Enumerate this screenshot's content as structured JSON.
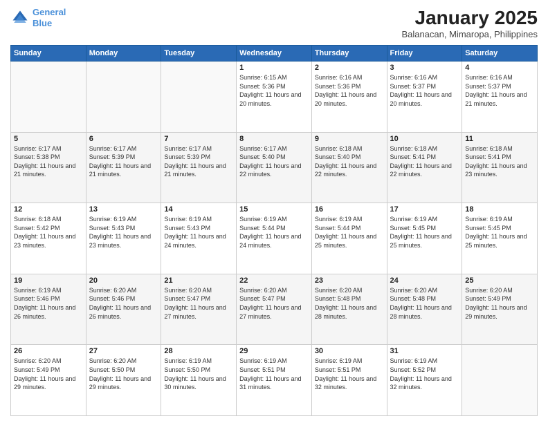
{
  "header": {
    "logo_line1": "General",
    "logo_line2": "Blue",
    "month_title": "January 2025",
    "location": "Balanacan, Mimaropa, Philippines"
  },
  "days_of_week": [
    "Sunday",
    "Monday",
    "Tuesday",
    "Wednesday",
    "Thursday",
    "Friday",
    "Saturday"
  ],
  "weeks": [
    [
      {
        "day": "",
        "sunrise": "",
        "sunset": "",
        "daylight": ""
      },
      {
        "day": "",
        "sunrise": "",
        "sunset": "",
        "daylight": ""
      },
      {
        "day": "",
        "sunrise": "",
        "sunset": "",
        "daylight": ""
      },
      {
        "day": "1",
        "sunrise": "Sunrise: 6:15 AM",
        "sunset": "Sunset: 5:36 PM",
        "daylight": "Daylight: 11 hours and 20 minutes."
      },
      {
        "day": "2",
        "sunrise": "Sunrise: 6:16 AM",
        "sunset": "Sunset: 5:36 PM",
        "daylight": "Daylight: 11 hours and 20 minutes."
      },
      {
        "day": "3",
        "sunrise": "Sunrise: 6:16 AM",
        "sunset": "Sunset: 5:37 PM",
        "daylight": "Daylight: 11 hours and 20 minutes."
      },
      {
        "day": "4",
        "sunrise": "Sunrise: 6:16 AM",
        "sunset": "Sunset: 5:37 PM",
        "daylight": "Daylight: 11 hours and 21 minutes."
      }
    ],
    [
      {
        "day": "5",
        "sunrise": "Sunrise: 6:17 AM",
        "sunset": "Sunset: 5:38 PM",
        "daylight": "Daylight: 11 hours and 21 minutes."
      },
      {
        "day": "6",
        "sunrise": "Sunrise: 6:17 AM",
        "sunset": "Sunset: 5:39 PM",
        "daylight": "Daylight: 11 hours and 21 minutes."
      },
      {
        "day": "7",
        "sunrise": "Sunrise: 6:17 AM",
        "sunset": "Sunset: 5:39 PM",
        "daylight": "Daylight: 11 hours and 21 minutes."
      },
      {
        "day": "8",
        "sunrise": "Sunrise: 6:17 AM",
        "sunset": "Sunset: 5:40 PM",
        "daylight": "Daylight: 11 hours and 22 minutes."
      },
      {
        "day": "9",
        "sunrise": "Sunrise: 6:18 AM",
        "sunset": "Sunset: 5:40 PM",
        "daylight": "Daylight: 11 hours and 22 minutes."
      },
      {
        "day": "10",
        "sunrise": "Sunrise: 6:18 AM",
        "sunset": "Sunset: 5:41 PM",
        "daylight": "Daylight: 11 hours and 22 minutes."
      },
      {
        "day": "11",
        "sunrise": "Sunrise: 6:18 AM",
        "sunset": "Sunset: 5:41 PM",
        "daylight": "Daylight: 11 hours and 23 minutes."
      }
    ],
    [
      {
        "day": "12",
        "sunrise": "Sunrise: 6:18 AM",
        "sunset": "Sunset: 5:42 PM",
        "daylight": "Daylight: 11 hours and 23 minutes."
      },
      {
        "day": "13",
        "sunrise": "Sunrise: 6:19 AM",
        "sunset": "Sunset: 5:43 PM",
        "daylight": "Daylight: 11 hours and 23 minutes."
      },
      {
        "day": "14",
        "sunrise": "Sunrise: 6:19 AM",
        "sunset": "Sunset: 5:43 PM",
        "daylight": "Daylight: 11 hours and 24 minutes."
      },
      {
        "day": "15",
        "sunrise": "Sunrise: 6:19 AM",
        "sunset": "Sunset: 5:44 PM",
        "daylight": "Daylight: 11 hours and 24 minutes."
      },
      {
        "day": "16",
        "sunrise": "Sunrise: 6:19 AM",
        "sunset": "Sunset: 5:44 PM",
        "daylight": "Daylight: 11 hours and 25 minutes."
      },
      {
        "day": "17",
        "sunrise": "Sunrise: 6:19 AM",
        "sunset": "Sunset: 5:45 PM",
        "daylight": "Daylight: 11 hours and 25 minutes."
      },
      {
        "day": "18",
        "sunrise": "Sunrise: 6:19 AM",
        "sunset": "Sunset: 5:45 PM",
        "daylight": "Daylight: 11 hours and 25 minutes."
      }
    ],
    [
      {
        "day": "19",
        "sunrise": "Sunrise: 6:19 AM",
        "sunset": "Sunset: 5:46 PM",
        "daylight": "Daylight: 11 hours and 26 minutes."
      },
      {
        "day": "20",
        "sunrise": "Sunrise: 6:20 AM",
        "sunset": "Sunset: 5:46 PM",
        "daylight": "Daylight: 11 hours and 26 minutes."
      },
      {
        "day": "21",
        "sunrise": "Sunrise: 6:20 AM",
        "sunset": "Sunset: 5:47 PM",
        "daylight": "Daylight: 11 hours and 27 minutes."
      },
      {
        "day": "22",
        "sunrise": "Sunrise: 6:20 AM",
        "sunset": "Sunset: 5:47 PM",
        "daylight": "Daylight: 11 hours and 27 minutes."
      },
      {
        "day": "23",
        "sunrise": "Sunrise: 6:20 AM",
        "sunset": "Sunset: 5:48 PM",
        "daylight": "Daylight: 11 hours and 28 minutes."
      },
      {
        "day": "24",
        "sunrise": "Sunrise: 6:20 AM",
        "sunset": "Sunset: 5:48 PM",
        "daylight": "Daylight: 11 hours and 28 minutes."
      },
      {
        "day": "25",
        "sunrise": "Sunrise: 6:20 AM",
        "sunset": "Sunset: 5:49 PM",
        "daylight": "Daylight: 11 hours and 29 minutes."
      }
    ],
    [
      {
        "day": "26",
        "sunrise": "Sunrise: 6:20 AM",
        "sunset": "Sunset: 5:49 PM",
        "daylight": "Daylight: 11 hours and 29 minutes."
      },
      {
        "day": "27",
        "sunrise": "Sunrise: 6:20 AM",
        "sunset": "Sunset: 5:50 PM",
        "daylight": "Daylight: 11 hours and 29 minutes."
      },
      {
        "day": "28",
        "sunrise": "Sunrise: 6:19 AM",
        "sunset": "Sunset: 5:50 PM",
        "daylight": "Daylight: 11 hours and 30 minutes."
      },
      {
        "day": "29",
        "sunrise": "Sunrise: 6:19 AM",
        "sunset": "Sunset: 5:51 PM",
        "daylight": "Daylight: 11 hours and 31 minutes."
      },
      {
        "day": "30",
        "sunrise": "Sunrise: 6:19 AM",
        "sunset": "Sunset: 5:51 PM",
        "daylight": "Daylight: 11 hours and 32 minutes."
      },
      {
        "day": "31",
        "sunrise": "Sunrise: 6:19 AM",
        "sunset": "Sunset: 5:52 PM",
        "daylight": "Daylight: 11 hours and 32 minutes."
      },
      {
        "day": "",
        "sunrise": "",
        "sunset": "",
        "daylight": ""
      }
    ]
  ]
}
